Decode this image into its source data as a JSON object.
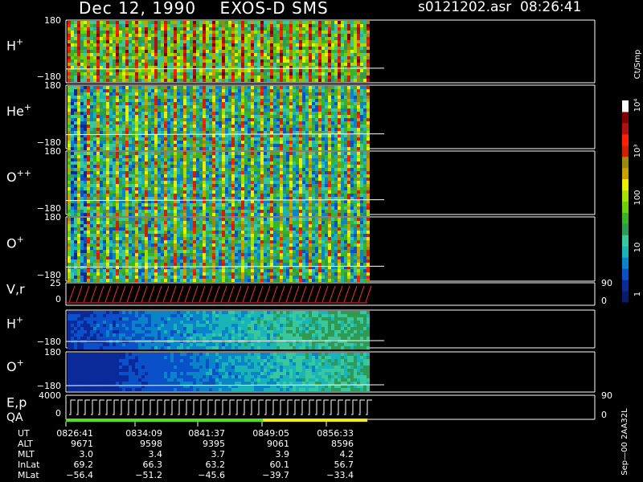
{
  "header": {
    "title_left": "Dec 12, 1990    EXOS-D SMS",
    "title_right": "s0121202.asr  08:26:41"
  },
  "colorbar": {
    "unit_label": "Ct/Smp",
    "tick_labels": [
      "10⁴",
      "10³",
      "100",
      "10",
      "1"
    ],
    "colors": [
      "#0a1a6e",
      "#0a2a9a",
      "#0a50c8",
      "#0a84c8",
      "#18b4b8",
      "#38c8a0",
      "#2e9a52",
      "#38b428",
      "#6ad010",
      "#a8e000",
      "#e8f000",
      "#c8a000",
      "#9a8a10",
      "#d02000",
      "#ff2000",
      "#b01010",
      "#800000",
      "#ffffff"
    ]
  },
  "time_axis": {
    "rows": [
      {
        "label": "UT",
        "values": [
          "0826:41",
          "0834:09",
          "0841:37",
          "0849:05",
          "0856:33"
        ]
      },
      {
        "label": "ALT",
        "values": [
          "9671",
          "9598",
          "9395",
          "9061",
          "8596"
        ]
      },
      {
        "label": "MLT",
        "values": [
          "3.0",
          "3.4",
          "3.7",
          "3.9",
          "4.2"
        ]
      },
      {
        "label": "InLat",
        "values": [
          "69.2",
          "66.3",
          "63.2",
          "60.1",
          "56.7"
        ]
      },
      {
        "label": "MLat",
        "values": [
          "−56.4",
          "−51.2",
          "−45.6",
          "−39.7",
          "−33.4"
        ]
      }
    ]
  },
  "footer": {
    "right_text": "Sep—00  2AA32L"
  },
  "chart_data": {
    "type": "heatmap",
    "panels": [
      {
        "id": "h-plus-1",
        "species": "H",
        "charge": "+",
        "y_top": "180",
        "y_bottom": "−180"
      },
      {
        "id": "he-plus",
        "species": "He",
        "charge": "+",
        "y_top": "180",
        "y_bottom": "−180"
      },
      {
        "id": "o-pp",
        "species": "O",
        "charge": "++",
        "y_top": "180",
        "y_bottom": "−180"
      },
      {
        "id": "o-plus-1",
        "species": "O",
        "charge": "+",
        "y_top": "180",
        "y_bottom": "−180"
      },
      {
        "id": "vr",
        "species": "V,r",
        "charge": "",
        "y_top": "25",
        "y_bottom": "0",
        "right_top": "90",
        "right_bottom": "0"
      },
      {
        "id": "h-plus-2",
        "species": "H",
        "charge": "+",
        "y_top": "",
        "y_bottom": "−180"
      },
      {
        "id": "o-plus-2",
        "species": "O",
        "charge": "+",
        "y_top": "180",
        "y_bottom": "−180"
      },
      {
        "id": "ep",
        "species": "E,p",
        "charge": "",
        "y_top": "4000",
        "y_bottom": "0",
        "right_top": "90",
        "right_bottom": "0"
      }
    ],
    "qa_label": "QA"
  }
}
